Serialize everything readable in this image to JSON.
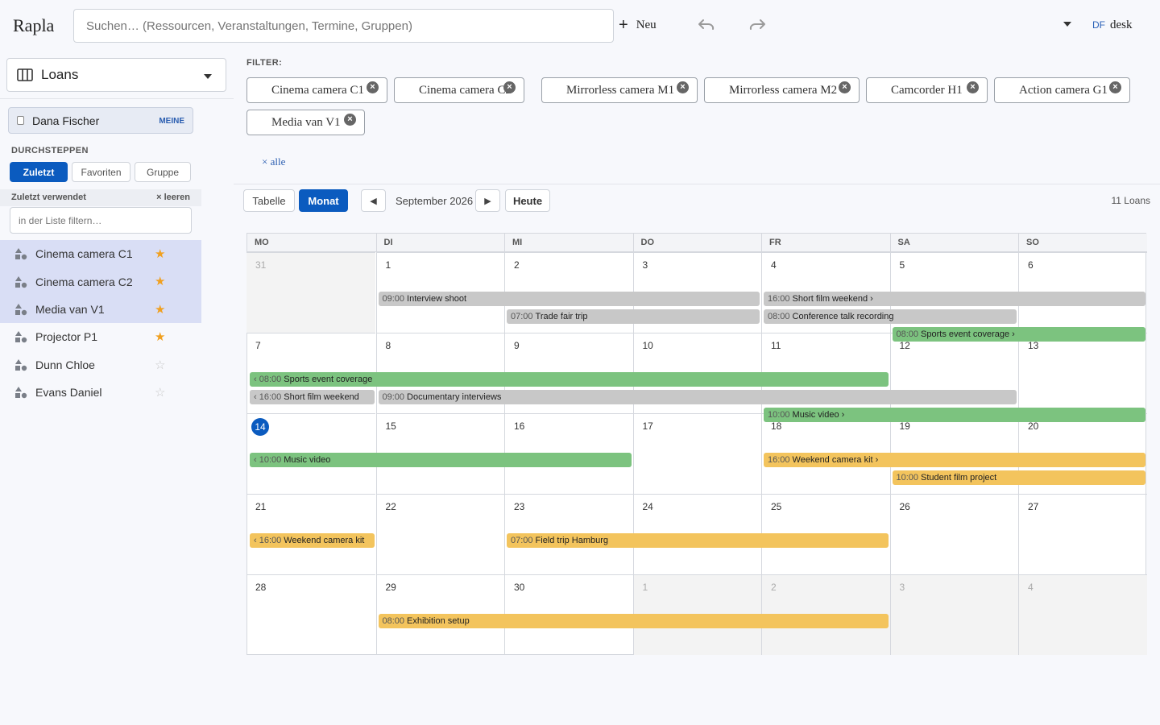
{
  "header": {
    "logo": "Rapla",
    "search_placeholder": "Suchen… (Ressourcen, Veranstaltungen, Termine, Gruppen)",
    "new_label": "Neu",
    "user_initials": "DF",
    "user_name": "desk"
  },
  "sidebar": {
    "view": "Loans",
    "user_chip": {
      "name": "Dana Fischer",
      "badge": "MEINE"
    },
    "browse_title": "DURCHSTEPPEN",
    "tabs": [
      "Zuletzt",
      "Favoriten",
      "Gruppe"
    ],
    "recent_title": "Zuletzt verwendet",
    "clear_label": "× leeren",
    "list_filter_placeholder": "in der Liste filtern…",
    "items": [
      {
        "label": "Cinema camera C1",
        "star": "★",
        "selected": true,
        "favorite": true
      },
      {
        "label": "Cinema camera C2",
        "star": "★",
        "selected": true,
        "favorite": true
      },
      {
        "label": "Media van V1",
        "star": "★",
        "selected": true,
        "favorite": true
      },
      {
        "label": "Projector P1",
        "star": "★",
        "selected": false,
        "favorite": true
      },
      {
        "label": "Dunn Chloe",
        "star": "☆",
        "selected": false,
        "favorite": false
      },
      {
        "label": "Evans Daniel",
        "star": "☆",
        "selected": false,
        "favorite": false
      }
    ]
  },
  "filter": {
    "label": "FILTER:",
    "chips": [
      "Cinema camera C1",
      "Cinema camera C2",
      "Mirrorless camera M1",
      "Mirrorless camera M2",
      "Camcorder H1",
      "Action camera G1",
      "Media van V1"
    ],
    "clear_all": "× alle"
  },
  "toolbar": {
    "table_label": "Tabelle",
    "month_label": "Monat",
    "prev": "◀",
    "next": "▶",
    "period": "September 2026",
    "today_label": "Heute",
    "count": "11 Loans"
  },
  "calendar": {
    "day_names": [
      "MO",
      "DI",
      "MI",
      "DO",
      "FR",
      "SA",
      "SO"
    ],
    "weeks": [
      [
        {
          "d": "31",
          "out": true
        },
        {
          "d": "1"
        },
        {
          "d": "2"
        },
        {
          "d": "3"
        },
        {
          "d": "4"
        },
        {
          "d": "5"
        },
        {
          "d": "6"
        }
      ],
      [
        {
          "d": "7"
        },
        {
          "d": "8"
        },
        {
          "d": "9"
        },
        {
          "d": "10"
        },
        {
          "d": "11"
        },
        {
          "d": "12"
        },
        {
          "d": "13"
        }
      ],
      [
        {
          "d": "14",
          "today": true
        },
        {
          "d": "15"
        },
        {
          "d": "16"
        },
        {
          "d": "17"
        },
        {
          "d": "18"
        },
        {
          "d": "19"
        },
        {
          "d": "20"
        }
      ],
      [
        {
          "d": "21"
        },
        {
          "d": "22"
        },
        {
          "d": "23"
        },
        {
          "d": "24"
        },
        {
          "d": "25"
        },
        {
          "d": "26"
        },
        {
          "d": "27"
        }
      ],
      [
        {
          "d": "28"
        },
        {
          "d": "29"
        },
        {
          "d": "30"
        },
        {
          "d": "1",
          "out": true
        },
        {
          "d": "2",
          "out": true
        },
        {
          "d": "3",
          "out": true
        },
        {
          "d": "4",
          "out": true
        }
      ]
    ],
    "events": [
      {
        "week": 0,
        "start": 1,
        "end": 4,
        "lane": 0,
        "color": "grey",
        "time": "09:00",
        "title": "Interview shoot"
      },
      {
        "week": 0,
        "start": 4,
        "end": 7,
        "lane": 0,
        "color": "grey",
        "time": "16:00",
        "title": "Short film weekend ›"
      },
      {
        "week": 0,
        "start": 2,
        "end": 4,
        "lane": 1,
        "color": "grey",
        "time": "07:00",
        "title": "Trade fair trip"
      },
      {
        "week": 0,
        "start": 4,
        "end": 6,
        "lane": 1,
        "color": "grey",
        "time": "08:00",
        "title": "Conference talk recording"
      },
      {
        "week": 0,
        "start": 5,
        "end": 7,
        "lane": 2,
        "color": "green",
        "time": "08:00",
        "title": "Sports event coverage ›"
      },
      {
        "week": 1,
        "start": 0,
        "end": 5,
        "lane": 0,
        "color": "green",
        "time": "‹ 08:00",
        "title": "Sports event coverage"
      },
      {
        "week": 1,
        "start": 0,
        "end": 1,
        "lane": 1,
        "color": "grey",
        "time": "‹ 16:00",
        "title": "Short film weekend"
      },
      {
        "week": 1,
        "start": 1,
        "end": 6,
        "lane": 1,
        "color": "grey",
        "time": "09:00",
        "title": "Documentary interviews"
      },
      {
        "week": 1,
        "start": 4,
        "end": 7,
        "lane": 2,
        "color": "green",
        "time": "10:00",
        "title": "Music video ›"
      },
      {
        "week": 2,
        "start": 0,
        "end": 3,
        "lane": 0,
        "color": "green",
        "time": "‹ 10:00",
        "title": "Music video"
      },
      {
        "week": 2,
        "start": 4,
        "end": 7,
        "lane": 0,
        "color": "yellow",
        "time": "16:00",
        "title": "Weekend camera kit ›"
      },
      {
        "week": 2,
        "start": 5,
        "end": 7,
        "lane": 1,
        "color": "yellow",
        "time": "10:00",
        "title": "Student film project"
      },
      {
        "week": 3,
        "start": 0,
        "end": 1,
        "lane": 0,
        "color": "yellow",
        "time": "‹ 16:00",
        "title": "Weekend camera kit"
      },
      {
        "week": 3,
        "start": 2,
        "end": 5,
        "lane": 0,
        "color": "yellow",
        "time": "07:00",
        "title": "Field trip Hamburg"
      },
      {
        "week": 4,
        "start": 1,
        "end": 5,
        "lane": 0,
        "color": "yellow",
        "time": "08:00",
        "title": "Exhibition setup"
      }
    ]
  }
}
